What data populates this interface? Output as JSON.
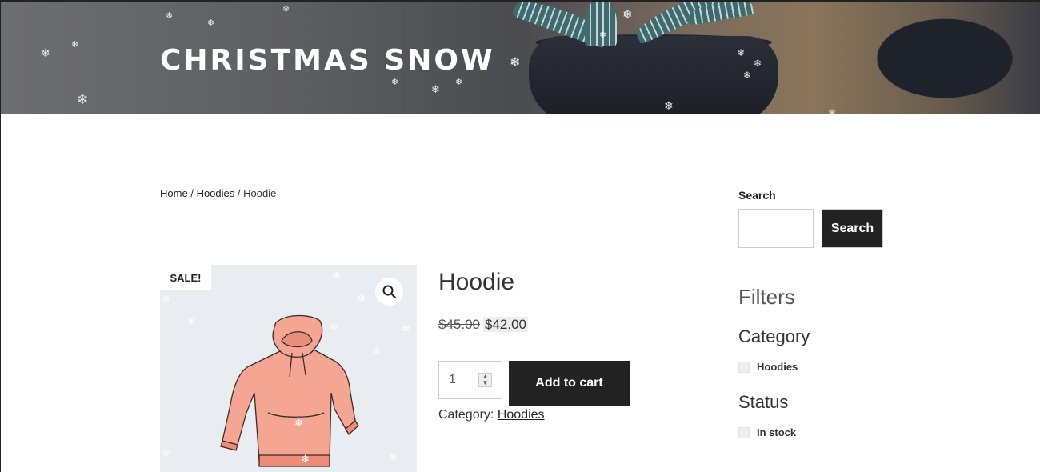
{
  "site": {
    "title": "CHRISTMAS SNOW"
  },
  "breadcrumb": {
    "home": "Home",
    "separator": "/",
    "category": "Hoodies",
    "current": "Hoodie"
  },
  "product": {
    "badge": "SALE!",
    "title": "Hoodie",
    "old_price": "$45.00",
    "new_price": "$42.00",
    "quantity": "1",
    "add_to_cart": "Add to cart",
    "category_label": "Category:",
    "category_link": "Hoodies",
    "zoom_icon": "magnifier-icon"
  },
  "sidebar": {
    "search_label": "Search",
    "search_placeholder": "",
    "search_button": "Search",
    "filters_title": "Filters",
    "category_title": "Category",
    "category_option": "Hoodies",
    "status_title": "Status",
    "status_option": "In stock"
  },
  "colors": {
    "dark": "#222222",
    "image_bg": "#e9edf1",
    "hoodie": "#f4a693"
  }
}
